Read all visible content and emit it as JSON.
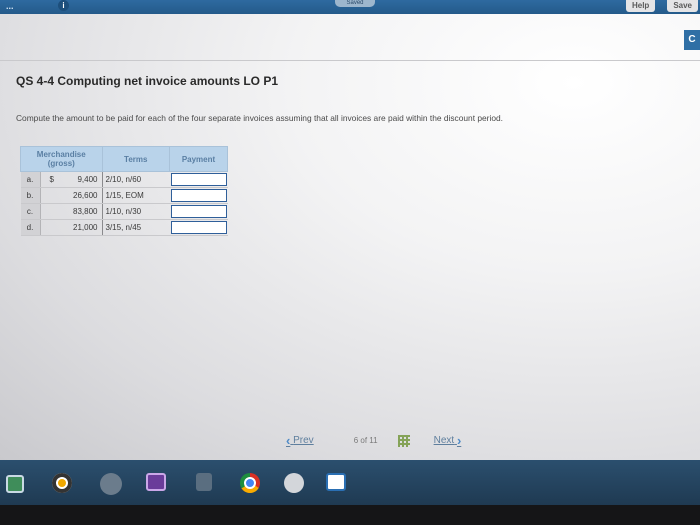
{
  "app": {
    "topbar_left": "...",
    "info_glyph": "i",
    "saved_label": "Saved",
    "help_label": "Help",
    "save_label": "Save"
  },
  "side_button": "C",
  "question": {
    "title": "QS 4-4 Computing net invoice amounts LO P1",
    "instructions": "Compute the amount to be paid for each of the four separate invoices assuming that all invoices are paid within the discount period."
  },
  "table": {
    "headers": {
      "merchandise_line1": "Merchandise",
      "merchandise_line2": "(gross)",
      "terms": "Terms",
      "payment": "Payment"
    },
    "rows": [
      {
        "letter": "a.",
        "currency": "$",
        "amount": "9,400",
        "terms": "2/10, n/60"
      },
      {
        "letter": "b.",
        "currency": "",
        "amount": "26,600",
        "terms": "1/15, EOM"
      },
      {
        "letter": "c.",
        "currency": "",
        "amount": "83,800",
        "terms": "1/10, n/30"
      },
      {
        "letter": "d.",
        "currency": "",
        "amount": "21,000",
        "terms": "3/15, n/45"
      }
    ]
  },
  "pagination": {
    "prev_label": "Prev",
    "page_current": "6",
    "page_of": "of",
    "page_total": "11",
    "next_label": "Next"
  },
  "taskbar": {
    "icons": [
      "store-icon",
      "media-icon",
      "hp-icon",
      "monitor-icon",
      "hand-icon",
      "chrome-icon",
      "music-icon",
      "mail-icon"
    ]
  }
}
